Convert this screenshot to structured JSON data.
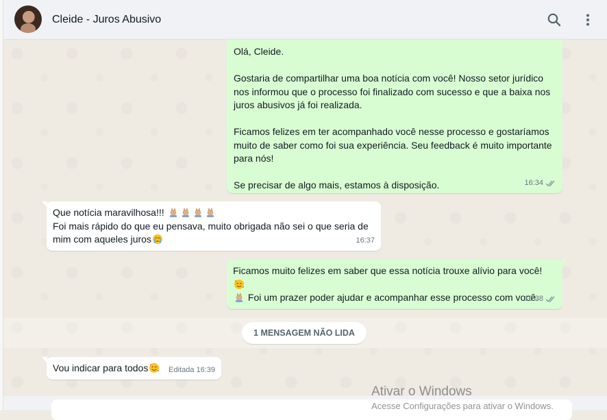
{
  "header": {
    "contact_name": "Cleide - Juros Abusivo",
    "icons": [
      "search-icon",
      "menu-dots-icon"
    ]
  },
  "messages": [
    {
      "direction": "outgoing",
      "text": "Olá, Cleide.\n\nGostaria de compartilhar uma boa notícia com você! Nosso setor jurídico\nnos informou que o processo foi finalizado com sucesso e que a baixa nos\njuros abusivos já foi realizada.\n\nFicamos felizes em ter acompanhado você nesse processo e gostaríamos\nmuito de saber como foi sua experiência. Seu feedback é muito importante\npara nós!\n\nSe precisar de algo mais, estamos à disposição.",
      "time": "16:34",
      "status": "read"
    },
    {
      "direction": "incoming",
      "line1": "Que notícia maravilhosa!!! ",
      "line1_emojis": [
        "folded-hands",
        "folded-hands",
        "folded-hands",
        "folded-hands"
      ],
      "line2": "Foi mais rápido do que eu pensava, muito obrigada não sei o que seria de",
      "line3": "mim com aqueles juros",
      "line3_emoji": "crying-face",
      "time": "16:37"
    },
    {
      "direction": "outgoing",
      "line1": "Ficamos muito felizes em saber que essa notícia trouxe alívio para você! ",
      "line1_emoji": "smiling-face-with-hearts",
      "line2": " Foi um prazer poder ajudar e acompanhar esse processo com você.",
      "line2_emoji": "folded-hands",
      "time": "16:38",
      "status": "read"
    },
    {
      "direction": "incoming",
      "text": "Vou indicar para todos",
      "emoji": "smiling-face-with-hearts",
      "edited_label": "Editada",
      "time": "16:39"
    }
  ],
  "unread_divider": "1 MENSAGEM NÃO LIDA",
  "windows_watermark": {
    "title": "Ativar o Windows",
    "subtitle": "Acesse Configurações para ativar o Windows."
  },
  "colors": {
    "outgoing_bubble": "#d9fdd3",
    "incoming_bubble": "#ffffff",
    "chat_background": "#efeae2",
    "read_tick": "#8696a0"
  }
}
